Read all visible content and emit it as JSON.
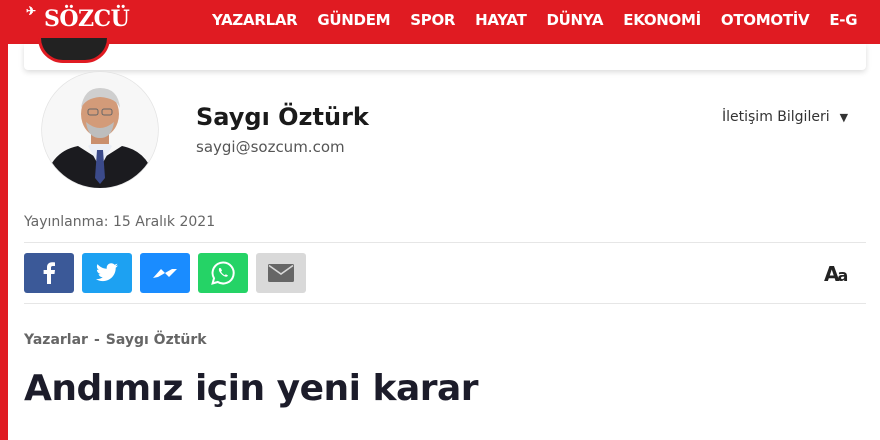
{
  "header": {
    "logo_text": "SÖZCÜ",
    "logo_mark": "✈",
    "nav_items": [
      "YAZARLAR",
      "GÜNDEM",
      "SPOR",
      "HAYAT",
      "DÜNYA",
      "EKONOMİ",
      "OTOMOTİV",
      "E-G"
    ]
  },
  "author": {
    "name": "Saygı Öztürk",
    "email": "saygi@sozcum.com",
    "contact_label": "İletişim Bilgileri",
    "contact_caret": "▼"
  },
  "article": {
    "published": "Yayınlanma: 15 Aralık 2021",
    "breadcrumb": {
      "section": "Yazarlar",
      "separator": "-",
      "author": "Saygı Öztürk"
    },
    "title": "Andımız için yeni karar"
  },
  "font_size_control": {
    "big": "A",
    "small": "a"
  },
  "colors": {
    "brand": "#e01b22",
    "facebook": "#3b5998",
    "twitter": "#1da1f2",
    "messenger": "#1a8cff",
    "whatsapp": "#25d366",
    "email": "#d9d9d9"
  },
  "share_icons": [
    "facebook-icon",
    "twitter-icon",
    "messenger-icon",
    "whatsapp-icon",
    "email-icon"
  ]
}
